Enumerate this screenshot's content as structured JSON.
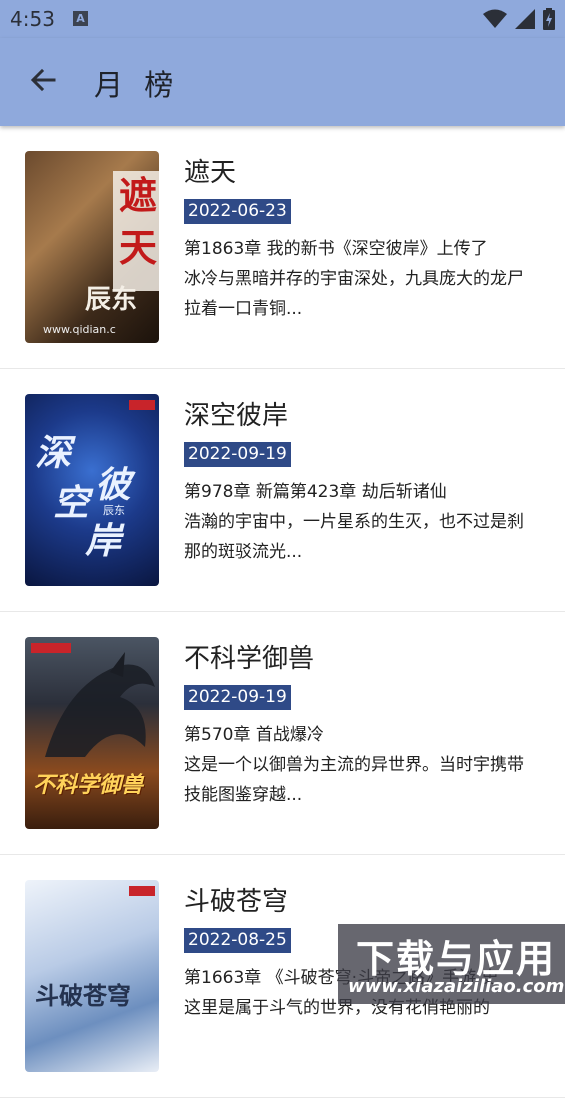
{
  "status_bar": {
    "time": "4:53",
    "notification_icon": "A",
    "icons": [
      "wifi-icon",
      "signal-icon",
      "battery-icon"
    ]
  },
  "app_bar": {
    "title": "月 榜",
    "back_icon": "arrow-left-icon"
  },
  "books": [
    {
      "title": "遮天",
      "date": "2022-06-23",
      "chapter": "第1863章 我的新书《深空彼岸》上传了",
      "description": "冰冷与黑暗并存的宇宙深处，九具庞大的龙尸拉着一口青铜...",
      "cover_text": [
        "遮",
        "天",
        "辰东",
        "www.qidian.c"
      ]
    },
    {
      "title": "深空彼岸",
      "date": "2022-09-19",
      "chapter": "第978章 新篇第423章 劫后斩诸仙",
      "description": "浩瀚的宇宙中，一片星系的生灭，也不过是刹那的斑驳流光...",
      "cover_text": [
        "深",
        "空",
        "彼",
        "岸",
        "辰东"
      ]
    },
    {
      "title": "不科学御兽",
      "date": "2022-09-19",
      "chapter": "第570章 首战爆冷",
      "description": "这是一个以御兽为主流的异世界。当时宇携带技能图鉴穿越...",
      "cover_text": [
        "不科学御兽"
      ]
    },
    {
      "title": "斗破苍穹",
      "date": "2022-08-25",
      "chapter": "第1663章 《斗破苍穹·斗帝之路》手游 史",
      "description": "这里是属于斗气的世界，没有花俏艳丽的",
      "cover_text": [
        "斗破苍穹"
      ]
    }
  ],
  "watermark": {
    "line1": "下载与应用",
    "line2": "www.xiazaiziliao.com"
  },
  "colors": {
    "appbar": "#8fa9dc",
    "date_badge": "#2f4a87"
  }
}
